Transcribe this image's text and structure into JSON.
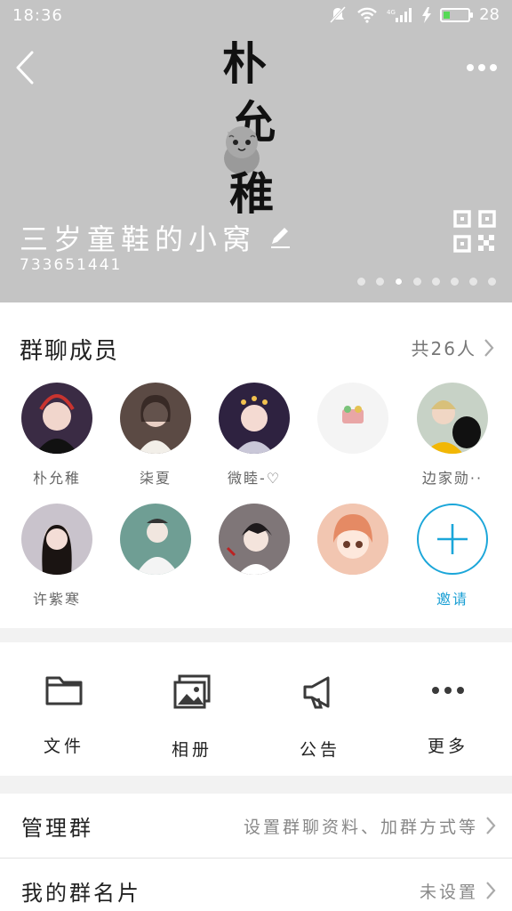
{
  "status_bar": {
    "time": "18:36",
    "signal_label": "4G",
    "battery_level": "28",
    "battery_fraction": 0.28
  },
  "header": {
    "logo_chars": [
      "朴",
      "允",
      "稚"
    ],
    "group_name": "三岁童鞋的小窝",
    "group_id": "733651441",
    "page_count": 8,
    "active_page": 3
  },
  "members": {
    "title": "群聊成员",
    "count_label": "共26人",
    "items": [
      {
        "name": "朴允稚",
        "avatar_color": "#3a2b44"
      },
      {
        "name": "柒夏",
        "avatar_color": "#5b4a44"
      },
      {
        "name": "微睦-♡",
        "avatar_color": "#2e2240"
      },
      {
        "name": "",
        "avatar_color": "#f4f4f4"
      },
      {
        "name": "边家勋··",
        "avatar_color": "#c7d2c6"
      },
      {
        "name": "许紫寒",
        "avatar_color": "#c9c3cc"
      },
      {
        "name": "",
        "avatar_color": "#6f9e94"
      },
      {
        "name": "",
        "avatar_color": "#3b3033"
      },
      {
        "name": "",
        "avatar_color": "#e8a88a"
      }
    ],
    "invite_label": "邀请"
  },
  "actions": [
    {
      "label": "文件",
      "icon": "folder-icon"
    },
    {
      "label": "相册",
      "icon": "photo-album-icon"
    },
    {
      "label": "公告",
      "icon": "megaphone-icon"
    },
    {
      "label": "更多",
      "icon": "more-dots-icon"
    }
  ],
  "settings": {
    "manage": {
      "title": "管理群",
      "value": "设置群聊资料、加群方式等"
    },
    "card": {
      "title": "我的群名片",
      "value": "未设置"
    }
  },
  "colors": {
    "accent": "#1ba6d9",
    "header_bg": "#c4c4c4"
  }
}
